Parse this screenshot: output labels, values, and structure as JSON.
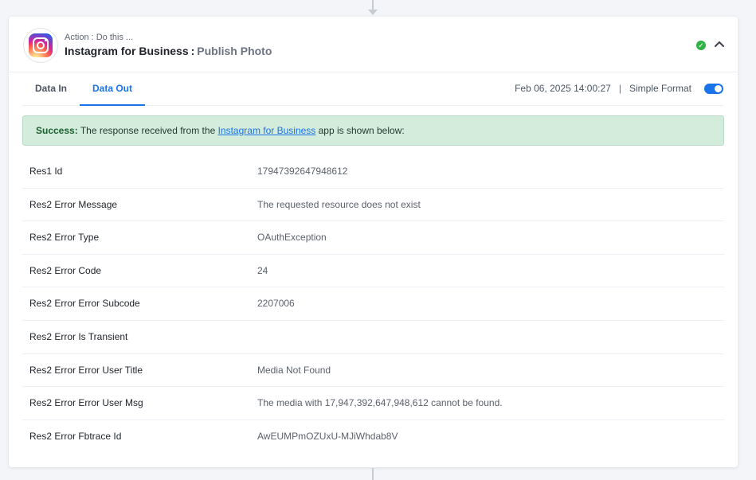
{
  "action": {
    "caption": "Action : Do this ...",
    "app_name": "Instagram for Business",
    "separator": ":",
    "operation": "Publish Photo",
    "status_icon": "check-icon",
    "collapse_icon": "chevron-up-icon"
  },
  "tabs": [
    {
      "label": "Data In",
      "active": false
    },
    {
      "label": "Data Out",
      "active": true
    }
  ],
  "meta": {
    "timestamp": "Feb 06, 2025 14:00:27",
    "pipe": "|",
    "format_label": "Simple Format",
    "format_enabled": true
  },
  "banner": {
    "prefix": "Success:",
    "text_before": " The response received from the ",
    "link": "Instagram for Business",
    "text_after": " app is shown below:"
  },
  "rows": [
    {
      "key": "Res1 Id",
      "value": "17947392647948612"
    },
    {
      "key": "Res2 Error Message",
      "value": "The requested resource does not exist"
    },
    {
      "key": "Res2 Error Type",
      "value": "OAuthException"
    },
    {
      "key": "Res2 Error Code",
      "value": "24"
    },
    {
      "key": "Res2 Error Error Subcode",
      "value": "2207006"
    },
    {
      "key": "Res2 Error Is Transient",
      "value": ""
    },
    {
      "key": "Res2 Error Error User Title",
      "value": "Media Not Found"
    },
    {
      "key": "Res2 Error Error User Msg",
      "value": "The media with 17,947,392,647,948,612 cannot be found."
    },
    {
      "key": "Res2 Error Fbtrace Id",
      "value": "AwEUMPmOZUxU-MJiWhdab8V"
    }
  ],
  "colors": {
    "accent": "#1a73e8",
    "success_bg": "#d4ecdc",
    "status_ok": "#2fb344"
  }
}
